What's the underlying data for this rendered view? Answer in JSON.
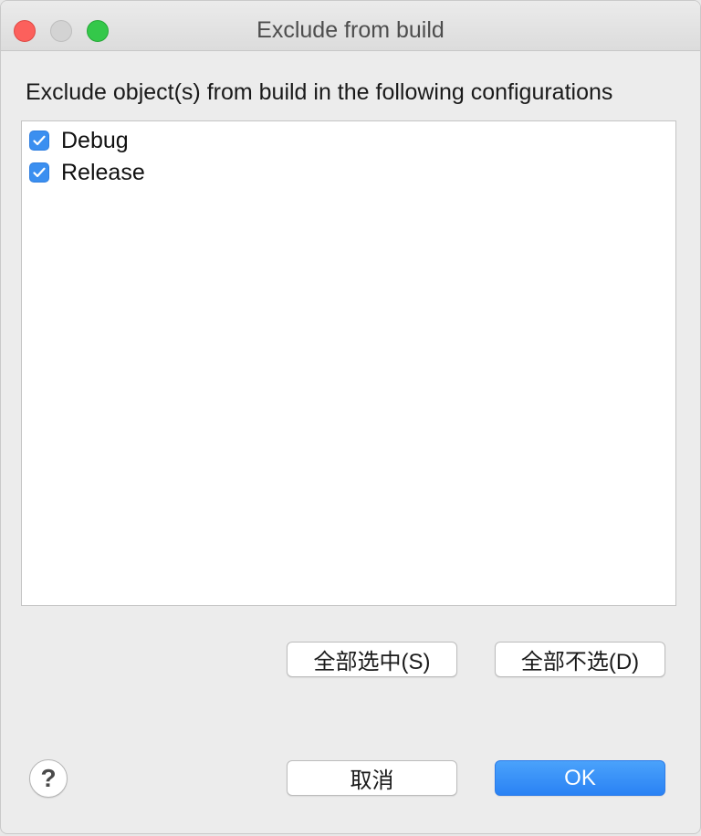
{
  "window": {
    "title": "Exclude from build"
  },
  "instruction": "Exclude object(s) from build in the following configurations",
  "configurations": [
    {
      "label": "Debug",
      "checked": true
    },
    {
      "label": "Release",
      "checked": true
    }
  ],
  "selection_buttons": {
    "select_all": "全部选中(S)",
    "deselect_all": "全部不选(D)"
  },
  "footer": {
    "help_icon": "?",
    "cancel": "取消",
    "ok": "OK"
  },
  "colors": {
    "accent": "#3b8ff0",
    "close": "#fc605c",
    "maximize": "#34c84a"
  }
}
